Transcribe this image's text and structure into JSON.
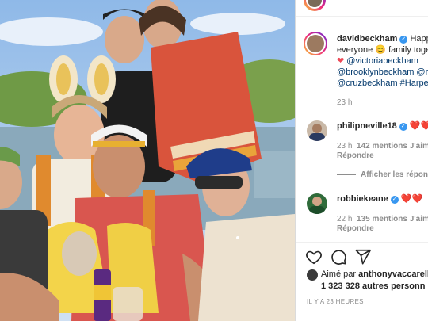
{
  "post": {
    "photo_alt": "family photo",
    "caption": {
      "username": "davidbeckham",
      "line1": "Happ",
      "line2_a": "everyone",
      "line2_b": "family toge",
      "line3": "@victoriabeckham",
      "line4": "@brooklynbeckham @r",
      "line5": "@cruzbeckham #Harpe",
      "time": "23 h"
    },
    "comments": [
      {
        "username": "philipneville18",
        "hearts": "❤️❤️",
        "time": "23 h",
        "likes": "142 mentions J'aim",
        "reply": "Répondre",
        "view_replies": "Afficher les répons"
      },
      {
        "username": "robbiekeane",
        "hearts": "❤️❤️",
        "time": "22 h",
        "likes": "135 mentions J'aim",
        "reply": "Répondre"
      }
    ],
    "liked_by": {
      "prefix": "Aimé par",
      "user": "anthonyvaccarell",
      "count": "1 323 328 autres personn"
    },
    "timestamp": "IL Y A 23 HEURES"
  },
  "icons": {
    "like": "heart-outline-icon",
    "comment": "comment-icon",
    "share": "paper-plane-icon",
    "verified": "verified-badge-icon"
  },
  "colors": {
    "verified": "#3897f0",
    "mention": "#00376b",
    "heart": "#ed4956"
  }
}
